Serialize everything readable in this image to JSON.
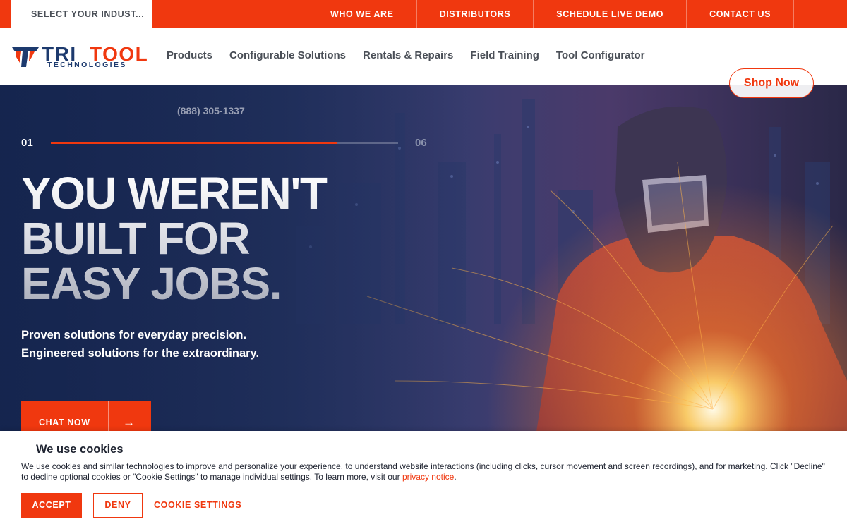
{
  "topbar": {
    "industry_select": "SELECT YOUR INDUST...",
    "links": [
      "WHO WE ARE",
      "DISTRIBUTORS",
      "SCHEDULE LIVE DEMO",
      "CONTACT US"
    ]
  },
  "logo": {
    "word1": "TRI",
    "word2": "TOOL",
    "tagline": "TECHNOLOGIES"
  },
  "nav": {
    "items": [
      "Products",
      "Configurable Solutions",
      "Rentals & Repairs",
      "Field Training",
      "Tool Configurator"
    ],
    "shop_label": "Shop Now"
  },
  "hero": {
    "phone": "(888) 305-1337",
    "slide_current": "01",
    "slide_total": "06",
    "slide_progress": 0.825,
    "headline": [
      "YOU WEREN'T",
      "BUILT FOR",
      "EASY JOBS."
    ],
    "subline": [
      "Proven solutions for everyday precision.",
      "Engineered solutions for the extraordinary."
    ],
    "chat_label": "CHAT NOW",
    "chat_arrow": "→"
  },
  "cookie": {
    "title": "We use cookies",
    "text": "We use cookies and similar technologies to improve and personalize your experience, to understand website interactions (including clicks, cursor movement and screen recordings), and for marketing. Click \"Decline\" to decline optional cookies or \"Cookie Settings\" to manage individual settings. To learn more, visit our ",
    "link_text": "privacy notice",
    "text_end": ".",
    "accept": "ACCEPT",
    "deny": "DENY",
    "settings": "COOKIE SETTINGS"
  },
  "colors": {
    "accent": "#f0380f",
    "navy": "#1d3a6e",
    "hero_bg": "#1a2a52"
  }
}
